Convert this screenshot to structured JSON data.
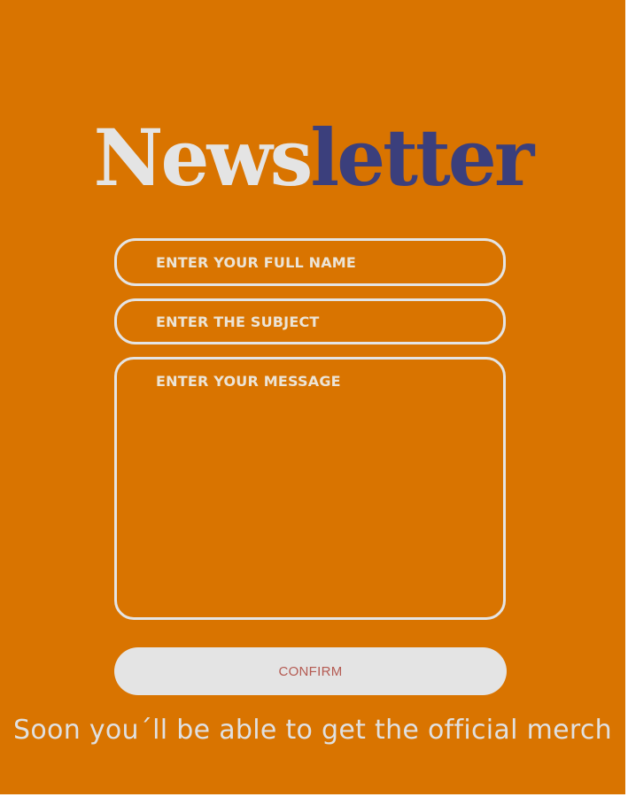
{
  "colors": {
    "background": "#d97400",
    "title_light": "#e4e4e4",
    "title_dark": "#3b3f7c",
    "field_border": "#e4e4e4",
    "button_bg": "#e4e4e4",
    "button_text": "#b45a52"
  },
  "header": {
    "title_part1": "News",
    "title_part2": "letter"
  },
  "form": {
    "name_placeholder": "ENTER YOUR FULL NAME",
    "subject_placeholder": "ENTER THE SUBJECT",
    "message_placeholder": "ENTER YOUR MESSAGE",
    "confirm_label": "CONFIRM"
  },
  "footer": {
    "text": "Soon you´ll be able to get the official merch"
  }
}
